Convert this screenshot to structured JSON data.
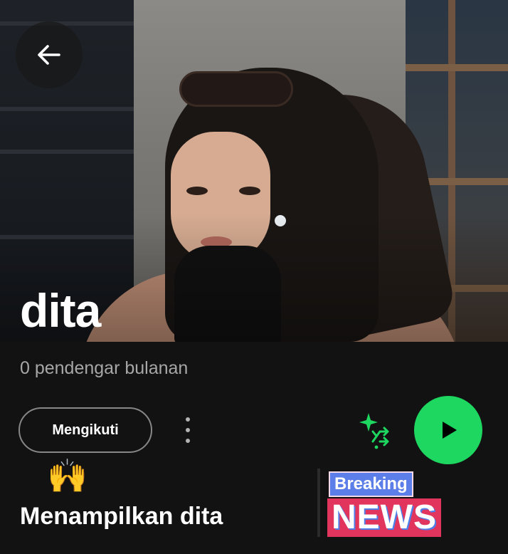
{
  "header": {
    "back_icon": "arrow-left-icon"
  },
  "artist": {
    "name": "dita",
    "monthly_listeners": "0 pendengar bulanan"
  },
  "actions": {
    "follow_label": "Mengikuti",
    "more_icon": "more-vertical-icon",
    "shuffle_icon": "smart-shuffle-icon",
    "play_icon": "play-icon"
  },
  "section": {
    "emoji": "🙌",
    "title": "Menampilkan dita"
  },
  "sticker": {
    "breaking": "Breaking",
    "news": "NEWS"
  },
  "colors": {
    "accent": "#1ed760",
    "background": "#121212",
    "muted_text": "#a7a7a7"
  }
}
